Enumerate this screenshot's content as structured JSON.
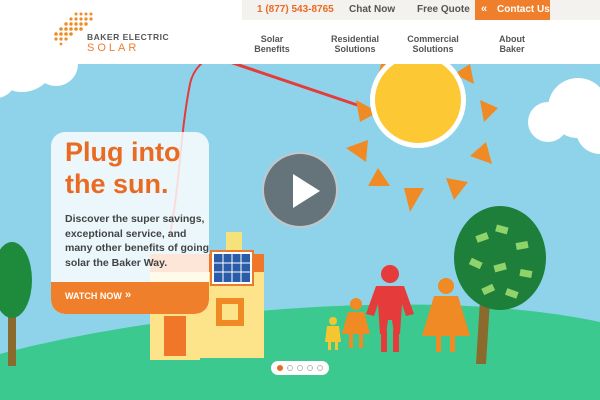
{
  "header": {
    "phone": "1 (877) 543-8765",
    "chat": "Chat Now",
    "quote": "Free Quote",
    "contact": "Contact Us",
    "contact_icon": "double-chevron-left-icon"
  },
  "logo": {
    "top": "BAKER ELECTRIC",
    "bottom": "SOLAR"
  },
  "nav": {
    "solar": "Solar\nBenefits",
    "residential": "Residential\nSolutions",
    "commercial": "Commercial\nSolutions",
    "about": "About\nBaker"
  },
  "hero": {
    "headline": "Plug into\nthe sun.",
    "tagline": "Discover the super savings, exceptional service, and many other benefits of going solar the Baker Way.",
    "cta": "WATCH NOW",
    "cta_icon": "double-chevron-right-icon",
    "play_icon": "play-icon"
  },
  "carousel": {
    "slides": 5,
    "active": 1
  },
  "colors": {
    "accent": "#ea6a22",
    "button": "#f07f2c",
    "sky": "#8fd3ea",
    "grass": "#3cc98f"
  }
}
